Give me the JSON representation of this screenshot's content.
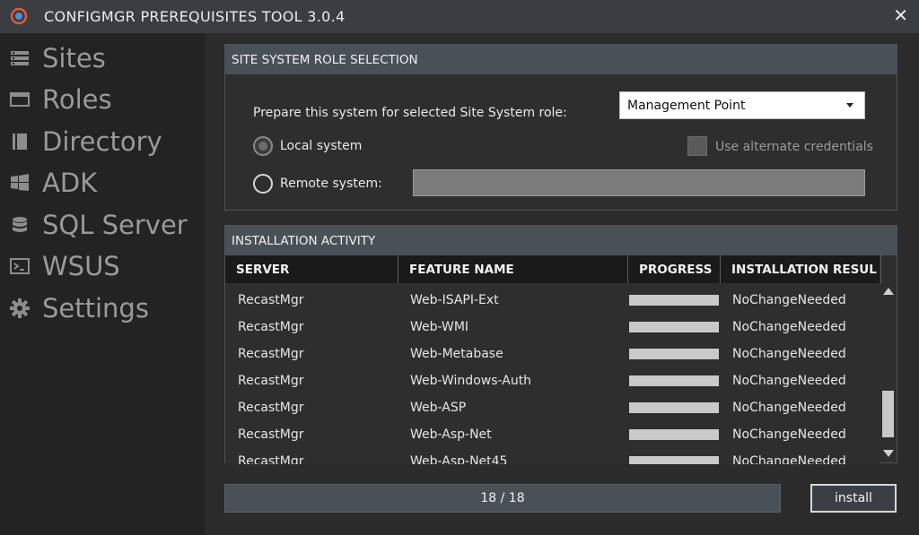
{
  "window": {
    "title": "CONFIGMGR PREREQUISITES TOOL 3.0.4",
    "close_symbol": "✕",
    "app_icon": "configmgr-logo-icon"
  },
  "sidebar": {
    "items": [
      {
        "label": "Sites",
        "icon": "list-icon"
      },
      {
        "label": "Roles",
        "icon": "window-icon"
      },
      {
        "label": "Directory",
        "icon": "book-icon"
      },
      {
        "label": "ADK",
        "icon": "windows-logo-icon"
      },
      {
        "label": "SQL Server",
        "icon": "database-icon"
      },
      {
        "label": "WSUS",
        "icon": "terminal-icon"
      },
      {
        "label": "Settings",
        "icon": "gear-icon"
      }
    ]
  },
  "role_panel": {
    "header": "SITE SYSTEM ROLE SELECTION",
    "prepare_label": "Prepare this system for selected Site System role:",
    "selected_role": "Management Point",
    "local_system_label": "Local system",
    "remote_system_label": "Remote system:",
    "remote_system_value": "",
    "alternate_credentials_label": "Use alternate credentials",
    "local_selected": true,
    "alternate_credentials_checked": false
  },
  "activity_panel": {
    "header": "INSTALLATION ACTIVITY",
    "columns": [
      "SERVER",
      "FEATURE NAME",
      "PROGRESS",
      "INSTALLATION RESUL"
    ],
    "rows": [
      {
        "server": "RecastMgr",
        "feature": "Web-ISAPI-Ext",
        "progress": 1.0,
        "result": "NoChangeNeeded"
      },
      {
        "server": "RecastMgr",
        "feature": "Web-WMI",
        "progress": 1.0,
        "result": "NoChangeNeeded"
      },
      {
        "server": "RecastMgr",
        "feature": "Web-Metabase",
        "progress": 1.0,
        "result": "NoChangeNeeded"
      },
      {
        "server": "RecastMgr",
        "feature": "Web-Windows-Auth",
        "progress": 1.0,
        "result": "NoChangeNeeded"
      },
      {
        "server": "RecastMgr",
        "feature": "Web-ASP",
        "progress": 1.0,
        "result": "NoChangeNeeded"
      },
      {
        "server": "RecastMgr",
        "feature": "Web-Asp-Net",
        "progress": 1.0,
        "result": "NoChangeNeeded"
      },
      {
        "server": "RecastMgr",
        "feature": "Web-Asp-Net45",
        "progress": 1.0,
        "result": "NoChangeNeeded"
      }
    ]
  },
  "footer": {
    "progress_text": "18 / 18",
    "progress_fraction": 1.0,
    "install_label": "install"
  },
  "colors": {
    "panel_header": "#4a5058",
    "background": "#2b2b2b",
    "sidebar": "#232323"
  }
}
